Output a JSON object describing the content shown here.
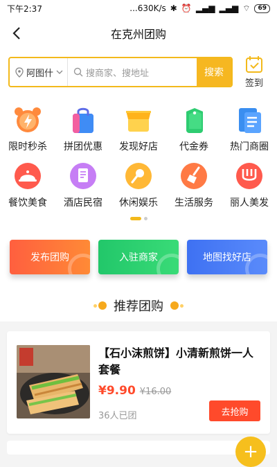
{
  "status_bar": {
    "time": "下午2:37",
    "network": "...630K/s",
    "battery": "69"
  },
  "header": {
    "title": "在克州团购"
  },
  "search": {
    "location": "阿图什",
    "placeholder": "搜商家、搜地址",
    "button": "搜索",
    "signin": "签到"
  },
  "categories": [
    {
      "label": "限时秒杀",
      "icon": "alarm-clock-icon",
      "color": "#ff8a3d"
    },
    {
      "label": "拼团优惠",
      "icon": "shopping-bag-icon",
      "color": "#7b5cf5"
    },
    {
      "label": "发现好店",
      "icon": "shop-icon",
      "color": "#ffc21a"
    },
    {
      "label": "代金券",
      "icon": "coupon-tag-icon",
      "color": "#2ecc71"
    },
    {
      "label": "热门商圈",
      "icon": "document-icon",
      "color": "#3a8ef0"
    },
    {
      "label": "餐饮美食",
      "icon": "food-dome-icon",
      "color": "#ff5a4d"
    },
    {
      "label": "酒店民宿",
      "icon": "hotel-icon",
      "color": "#c67ef5"
    },
    {
      "label": "休闲娱乐",
      "icon": "microphone-icon",
      "color": "#ffb836"
    },
    {
      "label": "生活服务",
      "icon": "broom-icon",
      "color": "#ff7a45"
    },
    {
      "label": "丽人美发",
      "icon": "comb-icon",
      "color": "#ff5a4d"
    }
  ],
  "actions": {
    "publish": "发布团购",
    "join": "入驻商家",
    "map": "地图找好店"
  },
  "section": {
    "title": "推荐团购"
  },
  "deal": {
    "name": "【石小沫煎饼】小清新煎饼一人套餐",
    "price": "¥9.90",
    "original_price": "¥16.00",
    "sold": "36人已团",
    "buy_button": "去抢购"
  },
  "colors": {
    "accent": "#f3b91b",
    "price": "#ff4a2b"
  }
}
